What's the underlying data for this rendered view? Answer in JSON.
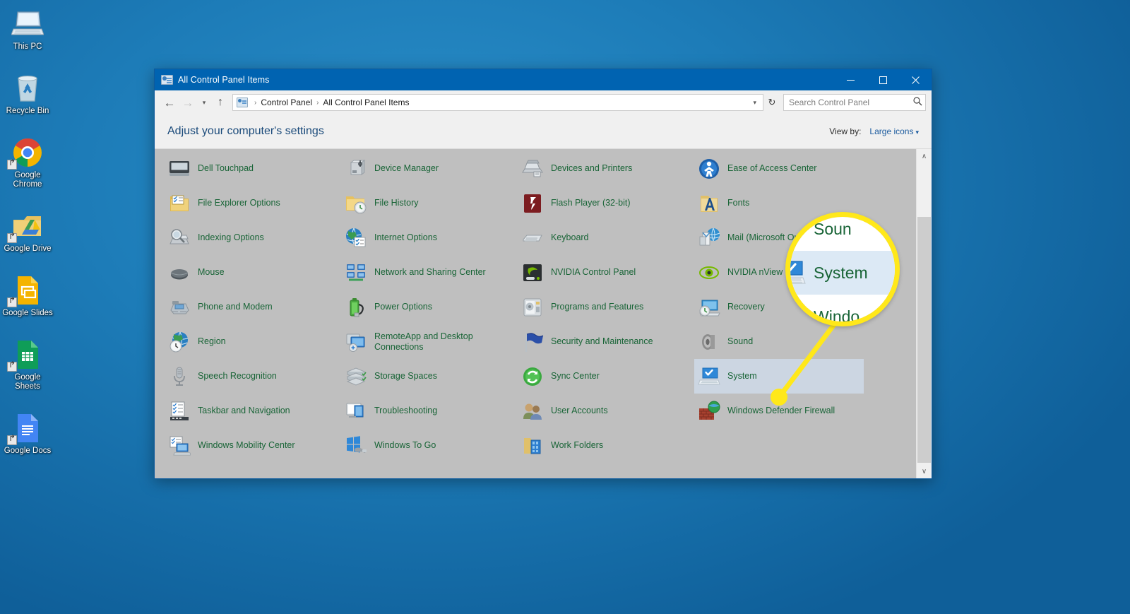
{
  "desktop": {
    "icons": [
      {
        "label": "This PC",
        "icon": "this-pc-icon",
        "shortcut": false
      },
      {
        "label": "Recycle Bin",
        "icon": "recycle-bin-icon",
        "shortcut": false
      },
      {
        "label": "Google Chrome",
        "icon": "google-chrome-icon",
        "shortcut": true
      },
      {
        "label": "Google Drive",
        "icon": "google-drive-icon",
        "shortcut": true
      },
      {
        "label": "Google Slides",
        "icon": "google-slides-icon",
        "shortcut": true
      },
      {
        "label": "Google Sheets",
        "icon": "google-sheets-icon",
        "shortcut": true
      },
      {
        "label": "Google Docs",
        "icon": "google-docs-icon",
        "shortcut": true
      }
    ],
    "wallpaper_color": "#1878b4"
  },
  "window": {
    "title": "All Control Panel Items",
    "title_icon": "control-panel-icon",
    "titlebar_color": "#0063b1",
    "buttons": {
      "minimize": "─",
      "maximize": "□",
      "close": "✕"
    }
  },
  "nav": {
    "back": "←",
    "forward": "→",
    "recent": "▾",
    "up": "↑",
    "refresh": "↻",
    "breadcrumb": {
      "icon": "control-panel-icon",
      "items": [
        "Control Panel",
        "All Control Panel Items"
      ],
      "separator": "›",
      "caret": "▾"
    }
  },
  "search": {
    "placeholder": "Search Control Panel",
    "icon": "search-icon"
  },
  "header": {
    "title": "Adjust your computer's settings",
    "view_by_label": "View by:",
    "view_by_value": "Large icons",
    "view_by_caret": "▾"
  },
  "scrollbar": {
    "up_arrow": "∧",
    "down_arrow": "∨"
  },
  "items": [
    {
      "label": "",
      "icon": "clipped-top-1"
    },
    {
      "label": "",
      "icon": "clipped-top-2"
    },
    {
      "label": "",
      "icon": "clipped-top-3"
    },
    {
      "label": "",
      "icon": "clipped-top-4"
    },
    {
      "label": "Dell Touchpad",
      "icon": "touchpad-icon"
    },
    {
      "label": "Device Manager",
      "icon": "device-manager-icon"
    },
    {
      "label": "Devices and Printers",
      "icon": "printer-icon"
    },
    {
      "label": "Ease of Access Center",
      "icon": "ease-of-access-icon"
    },
    {
      "label": "File Explorer Options",
      "icon": "folder-options-icon"
    },
    {
      "label": "File History",
      "icon": "file-history-icon"
    },
    {
      "label": "Flash Player (32-bit)",
      "icon": "flash-player-icon"
    },
    {
      "label": "Fonts",
      "icon": "fonts-icon"
    },
    {
      "label": "Indexing Options",
      "icon": "indexing-icon"
    },
    {
      "label": "Internet Options",
      "icon": "internet-options-icon"
    },
    {
      "label": "Keyboard",
      "icon": "keyboard-icon"
    },
    {
      "label": "Mail (Microsoft Outlook 2016)",
      "icon": "mail-icon"
    },
    {
      "label": "Mouse",
      "icon": "mouse-icon"
    },
    {
      "label": "Network and Sharing Center",
      "icon": "network-icon"
    },
    {
      "label": "NVIDIA Control Panel",
      "icon": "nvidia-control-panel-icon"
    },
    {
      "label": "NVIDIA nView Manager",
      "icon": "nvidia-nview-icon"
    },
    {
      "label": "Phone and Modem",
      "icon": "phone-modem-icon"
    },
    {
      "label": "Power Options",
      "icon": "power-options-icon"
    },
    {
      "label": "Programs and Features",
      "icon": "programs-features-icon"
    },
    {
      "label": "Recovery",
      "icon": "recovery-icon"
    },
    {
      "label": "Region",
      "icon": "region-icon"
    },
    {
      "label": "RemoteApp and Desktop Connections",
      "icon": "remoteapp-icon"
    },
    {
      "label": "Security and Maintenance",
      "icon": "security-flag-icon"
    },
    {
      "label": "Sound",
      "icon": "sound-icon"
    },
    {
      "label": "Speech Recognition",
      "icon": "microphone-icon"
    },
    {
      "label": "Storage Spaces",
      "icon": "storage-spaces-icon"
    },
    {
      "label": "Sync Center",
      "icon": "sync-center-icon"
    },
    {
      "label": "System",
      "icon": "system-icon",
      "selected": true
    },
    {
      "label": "Taskbar and Navigation",
      "icon": "taskbar-icon"
    },
    {
      "label": "Troubleshooting",
      "icon": "troubleshooting-icon"
    },
    {
      "label": "User Accounts",
      "icon": "user-accounts-icon"
    },
    {
      "label": "Windows Defender Firewall",
      "icon": "firewall-icon"
    },
    {
      "label": "Windows Mobility Center",
      "icon": "mobility-center-icon"
    },
    {
      "label": "Windows To Go",
      "icon": "windows-to-go-icon"
    },
    {
      "label": "Work Folders",
      "icon": "work-folders-icon"
    },
    {
      "label": "",
      "icon": "none"
    }
  ],
  "callout": {
    "highlight_color": "#ffe81a",
    "target_label": "System",
    "magnified_rows": [
      {
        "label": "Soun",
        "icon": "sound-icon",
        "highlighted": false
      },
      {
        "label": "System",
        "icon": "system-icon",
        "highlighted": true
      },
      {
        "label": "Windo",
        "icon": "firewall-icon",
        "highlighted": false
      }
    ]
  }
}
